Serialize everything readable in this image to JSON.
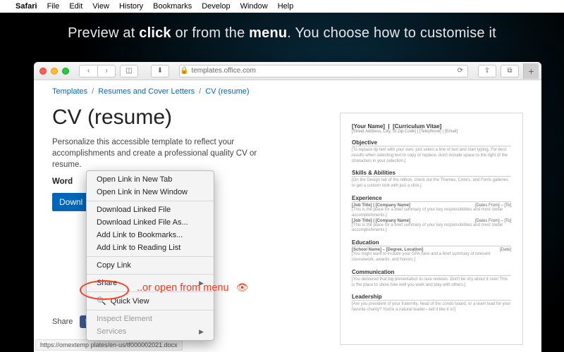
{
  "menubar": {
    "apple": "",
    "app": "Safari",
    "items": [
      "File",
      "Edit",
      "View",
      "History",
      "Bookmarks",
      "Develop",
      "Window",
      "Help"
    ]
  },
  "headline": {
    "pre": "Preview at ",
    "b1": "click",
    "mid": " or from the ",
    "b2": "menu",
    "post": ". You choose how to customise it"
  },
  "browser": {
    "url_host": "templates.office.com",
    "lock": "🔒",
    "reload": "⟳",
    "status_url": "https://omextemp                                                            plates/en-us/tf000002021.docx"
  },
  "crumbs": {
    "a": "Templates",
    "b": "Resumes and Cover Letters",
    "c": "CV (resume)"
  },
  "page": {
    "title": "CV (resume)",
    "desc": "Personalize this accessible template to reflect your accomplishments and create a professional quality CV or resume.",
    "word": "Word",
    "download": "Downl",
    "share": "Share"
  },
  "preview": {
    "name": "[Your Name]",
    "sub": "[Curriculum Vitae]",
    "sub2": "[Street Address, City, St Zip Code]  |  [Telephone]  |  [Email]",
    "sec_objective": "Objective",
    "objective_txt": "[To replace tip text with your own, just select a line of text and start typing. For best results when selecting text to copy or replace, don't include space to the right of the characters in your selection.]",
    "sec_skills": "Skills & Abilities",
    "skills_txt": "[On the Design tab of the ribbon, check out the Themes, Colors, and Fonts galleries to get a custom look with just a click.]",
    "sec_exp": "Experience",
    "job1_t": "[Job Title]  |  [Company Name]",
    "job1_d": "[Dates From] – [To]",
    "job1_txt": "[This is the place for a brief summary of your key responsibilities and most stellar accomplishments.]",
    "job2_t": "[Job Title]  |  [Company Name]",
    "job2_d": "[Dates From] – [To]",
    "job2_txt": "[This is the place for a brief summary of your key responsibilities and most stellar accomplishments.]",
    "sec_edu": "Education",
    "edu_t": "[School Name]  –  [Degree, Location]",
    "edu_d": "[Date]",
    "edu_txt": "[You might want to include your GPA here and a brief summary of relevant coursework, awards, and honors.]",
    "sec_comm": "Communication",
    "comm_txt": "[You delivered that big presentation to rave reviews. Don't be shy about it now! This is the place to show how well you work and play with others.]",
    "sec_lead": "Leadership",
    "lead_txt": "[Are you president of your fraternity, head of the condo board, or a team lead for your favorite charity? You're a natural leader—tell it like it is!]"
  },
  "ctx": {
    "i0": "Open Link in New Tab",
    "i1": "Open Link in New Window",
    "i2": "Download Linked File",
    "i3": "Download Linked File As...",
    "i4": "Add Link to Bookmarks...",
    "i5": "Add Link to Reading List",
    "i6": "Copy Link",
    "i7": "Share",
    "i8": "Quick View",
    "i9": "Inspect Element",
    "i10": "Services"
  },
  "annotation": {
    "text": "..or open from menu"
  }
}
